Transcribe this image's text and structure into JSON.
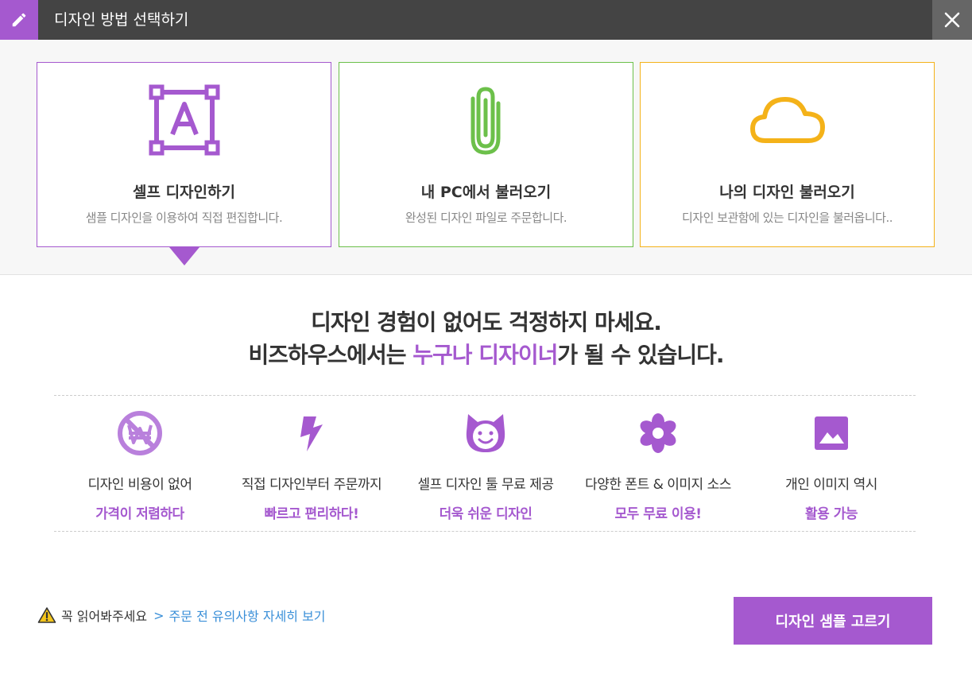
{
  "header": {
    "title": "디자인 방법 선택하기",
    "edit_icon": "pencil-icon",
    "close_icon": "close-icon",
    "accent": "#a559cf"
  },
  "options": [
    {
      "title": "셀프 디자인하기",
      "desc": "샘플 디자인을 이용하여 직접 편집합니다.",
      "icon": "text-frame-icon",
      "color": "#a559cf",
      "selected": true
    },
    {
      "title": "내 PC에서 불러오기",
      "desc": "완성된 디자인 파일로 주문합니다.",
      "icon": "paperclip-icon",
      "color": "#6cc04a"
    },
    {
      "title": "나의 디자인 불러오기",
      "desc": "디자인 보관함에 있는 디자인을 불러옵니다..",
      "icon": "cloud-icon",
      "color": "#f4b219"
    }
  ],
  "headline": {
    "line1": "디자인 경험이 없어도 걱정하지 마세요.",
    "line2_pre": "비즈하우스에서는 ",
    "line2_hl": "누구나 디자이너",
    "line2_post": "가 될 수 있습니다."
  },
  "features": [
    {
      "line1": "디자인 비용이 없어",
      "line2": "가격이 저렴하다",
      "icon": "no-won-icon"
    },
    {
      "line1": "직접 디자인부터 주문까지",
      "line2": "빠르고 편리하다!",
      "icon": "lightning-icon"
    },
    {
      "line1": "셀프 디자인 툴 무료 제공",
      "line2": "더욱 쉬운 디자인",
      "icon": "cat-icon"
    },
    {
      "line1": "다양한 폰트 & 이미지 소스",
      "line2": "모두 무료 이용!",
      "icon": "flower-icon"
    },
    {
      "line1": "개인 이미지 역시",
      "line2": "활용 가능",
      "icon": "image-icon"
    }
  ],
  "notice": {
    "text": "꼭 읽어봐주세요",
    "chevron": ">",
    "link": "주문 전 유의사항 자세히 보기",
    "icon": "warning-icon"
  },
  "cta": {
    "label": "디자인 샘플 고르기"
  }
}
